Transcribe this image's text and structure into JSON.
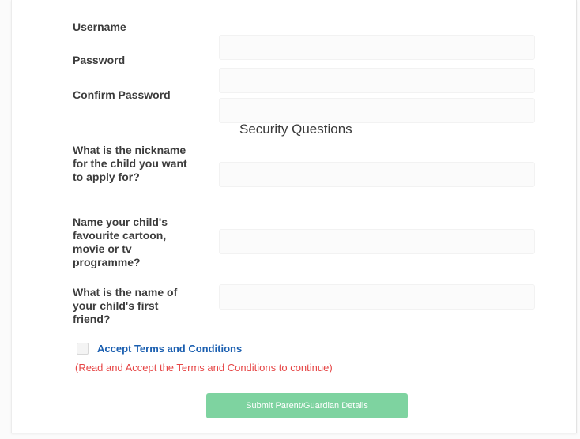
{
  "account": {
    "username_label": "Username",
    "username_value": "",
    "password_label": "Password",
    "password_value": "",
    "confirm_password_label": "Confirm Password",
    "confirm_password_value": ""
  },
  "security": {
    "title": "Security Questions",
    "questions": [
      {
        "label": "What is the nickname for the child you want to apply for?",
        "value": ""
      },
      {
        "label": "Name your child's favourite cartoon, movie or tv programme?",
        "value": ""
      },
      {
        "label": "What is the name of your child's first friend?",
        "value": ""
      }
    ]
  },
  "terms": {
    "checked": false,
    "link_label": "Accept Terms and Conditions",
    "warning": "(Read and Accept the Terms and Conditions to continue)"
  },
  "submit": {
    "label": "Submit Parent/Guardian Details"
  },
  "colors": {
    "link": "#1b5fb0",
    "warning": "#e64646",
    "submit_bg": "#7ed3a0"
  }
}
